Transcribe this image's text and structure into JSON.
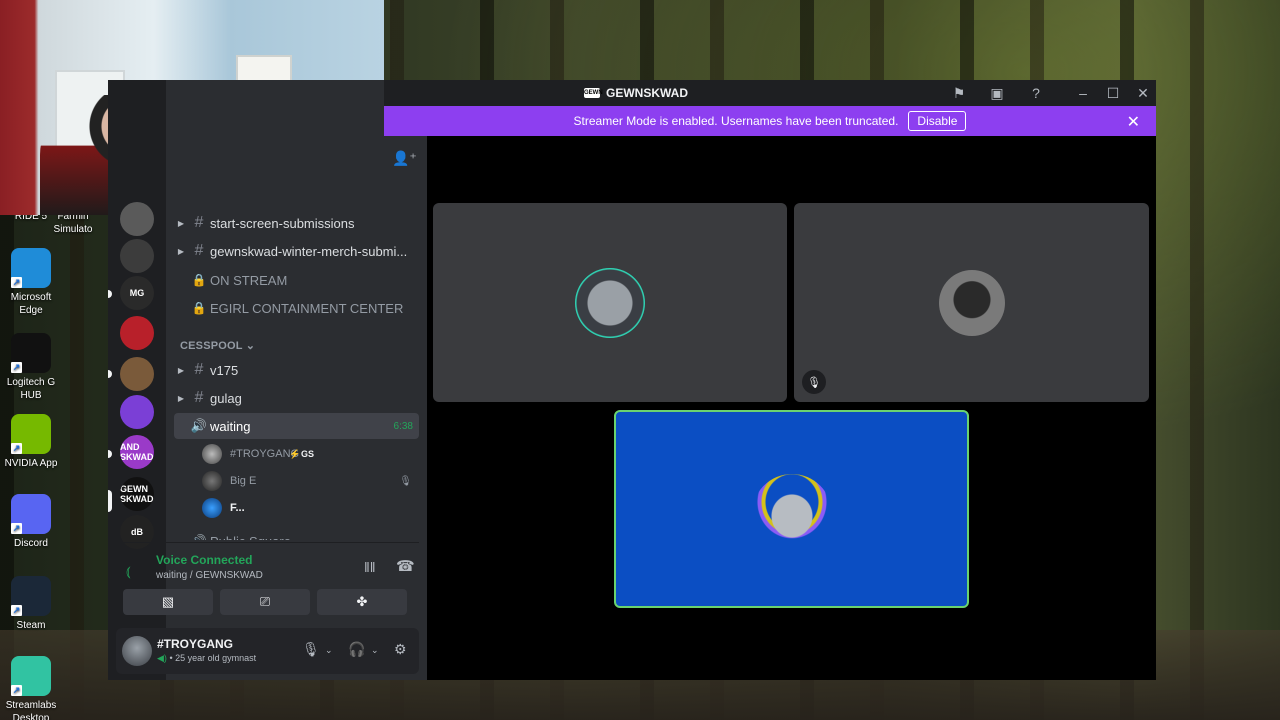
{
  "desktop": {
    "icons": [
      {
        "label": "RIDE 5",
        "icon": "ride-icon",
        "color": "#333333"
      },
      {
        "label": "Farmin Simulato",
        "icon": "farming-icon",
        "color": "#4a7a2a"
      },
      {
        "label": "Microsoft Edge",
        "icon": "edge-icon",
        "color": "#1f8cd8"
      },
      {
        "label": "Logitech G HUB",
        "icon": "logitech-icon",
        "color": "#111111"
      },
      {
        "label": "NVIDIA App",
        "icon": "nvidia-icon",
        "color": "#76b900"
      },
      {
        "label": "Discord",
        "icon": "discord-icon",
        "color": "#5865f2"
      },
      {
        "label": "Steam",
        "icon": "steam-icon",
        "color": "#1b2838"
      },
      {
        "label": "Streamlabs Desktop",
        "icon": "streamlabs-icon",
        "color": "#31c3a2"
      }
    ]
  },
  "window": {
    "title": "GEWNSKWAD",
    "server_logo": "GEWN"
  },
  "banner": {
    "text": "Streamer Mode is enabled. Usernames have been truncated.",
    "button": "Disable",
    "color": "#8d3ff0"
  },
  "guilds": [
    {
      "name": "server-1",
      "color": "#5a5a5a",
      "text": ""
    },
    {
      "name": "server-2",
      "color": "#3c3c3c",
      "text": ""
    },
    {
      "name": "server-3",
      "color": "#2a2a2a",
      "text": "MG"
    },
    {
      "name": "server-4",
      "color": "#b8202a",
      "text": ""
    },
    {
      "name": "server-5",
      "color": "#7a5a3a",
      "text": ""
    },
    {
      "name": "server-6",
      "color": "#7b3fd6",
      "text": ""
    },
    {
      "name": "server-7",
      "color": "#9a3ac8",
      "text": "AND SKWAD"
    },
    {
      "name": "server-8",
      "color": "#111111",
      "text": "GEWN SKWAD"
    },
    {
      "name": "server-9",
      "color": "#222222",
      "text": "dB"
    }
  ],
  "channels": {
    "list": [
      {
        "type": "text",
        "name": "start-screen-submissions",
        "caret": true
      },
      {
        "type": "text",
        "name": "gewnskwad-winter-merch-submi...",
        "caret": true
      },
      {
        "type": "locked",
        "name": "ON STREAM"
      },
      {
        "type": "locked",
        "name": "EGIRL CONTAINMENT CENTER"
      }
    ],
    "category": "CESSPOOL",
    "cesspool": [
      {
        "type": "text",
        "name": "v175",
        "caret": true
      },
      {
        "type": "text",
        "name": "gulag",
        "caret": true
      }
    ],
    "voice": {
      "name": "waiting",
      "time": "6:38",
      "users": [
        {
          "name": "#TROYGANG",
          "tag": "GS"
        },
        {
          "name": "Big E"
        },
        {
          "name": "F..."
        }
      ]
    },
    "partial": "Public Square"
  },
  "voice_connected": {
    "status": "Voice Connected",
    "location": "waiting / GEWNSKWAD"
  },
  "user": {
    "name": "#TROYGANG",
    "status": "• 25 year old gymnast"
  },
  "colors": {
    "online": "#23a55a",
    "speaking_border": "#6ad36f",
    "speaking_tile": "#0b4ec3"
  }
}
